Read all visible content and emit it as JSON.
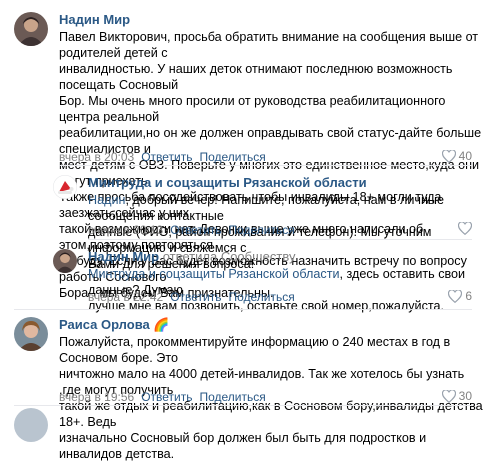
{
  "comments": [
    {
      "author": "Надин Мир",
      "text_lines": [
        "Павел Викторович, просьба обратить внимание на сообщения выше от родителей детей с",
        "инвалидностью. У наших деток отнимают последнюю возможность посещать Сосновый",
        "Бор. Мы очень много просили от руководства реабилитационного центра реальной",
        "реабилитации,но он же должен оправдывать свой статус-дайте больше специалистов и",
        "мест детям с ОВЗ. Поверьте у многих это единственное место,куда они могут приехать.",
        "Также просьба посодействовать,чтобы инвалиды 18+ могли туда заезжать,сейчас у них",
        "такой возможности нет. Девочки выше уже много написали об этом,поэтому повторяться",
        "не буду. Если у Вас будет возможность назначить встречу по вопросу работы Соснового",
        "Бора - мы будем Вам признательны."
      ],
      "time": "вчера в 20:03",
      "reply_label": "Ответить",
      "share_label": "Поделиться",
      "likes": "40"
    },
    {
      "author": "Минтруда и соцзащиты Рязанской области",
      "mention": "Надин",
      "text_lines": [
        ", добрый вечер! Напишите, пожалуйста, нам в личные сообщения контактные",
        "данные (ФИО, район проживания и телефон). Мы уточним информацию и свяжемся с",
        "Вами для решения вопроса!"
      ],
      "time": "вчера в 20:13",
      "reply_label": "Ответить",
      "share_label": "Поделиться"
    },
    {
      "author": "Надин Мир",
      "replied_to": "ответила Сообществу",
      "mention": "Минтруда и соцзащиты Рязанской области",
      "text_lines": [
        ", здесь оставить свои данные? Думаю",
        "лучше мне вам позвонить, оставьте свой номер,пожалуйста."
      ],
      "time": "вчера в 22:42",
      "reply_label": "Ответить",
      "share_label": "Поделиться",
      "likes": "6"
    },
    {
      "author": "Раиса Орлова",
      "author_emoji": "🌈",
      "text_lines": [
        "Пожалуйста, прокомментируйте информацию о 240 местах в год в Сосновом боре. Это",
        "ничтожно мало на 4000 детей-инвалидов. Так же хотелось бы узнать ,где могут получить",
        "такой же отдых и реабилитацию,как в Сосновом бору,инвалиды детства 18+. Ведь",
        "изначально Сосновый бор должен был быть для подростков и инвалидов детства."
      ],
      "time": "вчера в 19:56",
      "reply_label": "Ответить",
      "share_label": "Поделиться",
      "likes": "30"
    }
  ],
  "colors": {
    "link": "#2a5885",
    "meta": "#828282",
    "separator": "#e7e8ec"
  },
  "icons": {
    "like": "heart-icon",
    "share": "share-arrow-icon",
    "ministry_avatar": "santa-hat-logo-icon"
  }
}
